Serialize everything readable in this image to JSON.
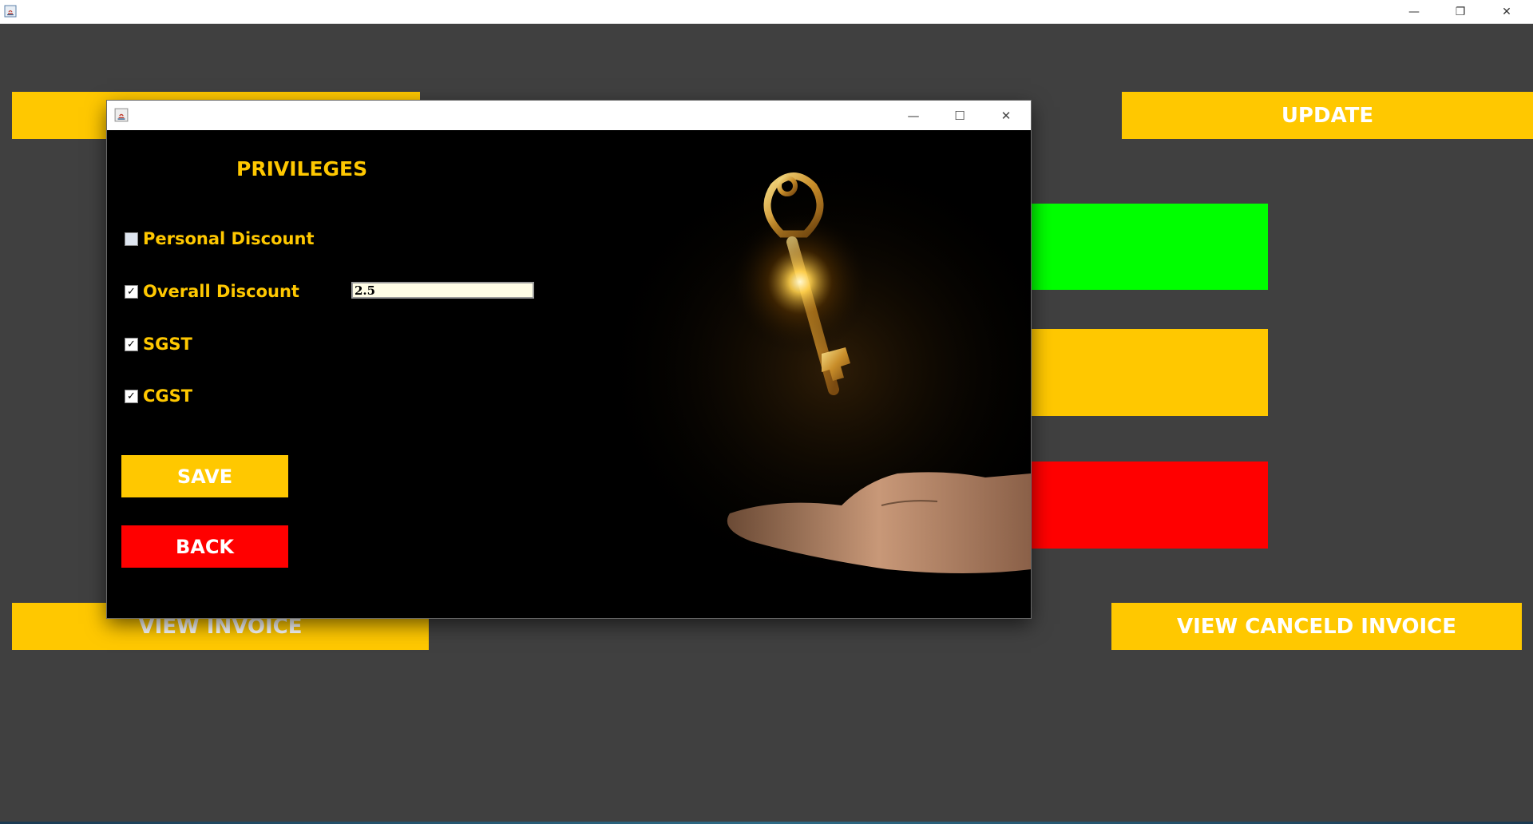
{
  "window": {
    "minimize_glyph": "—",
    "restore_glyph": "❐",
    "close_glyph": "✕"
  },
  "background": {
    "update_label": "UPDATE",
    "view_invoice_label": "VIEW INVOICE",
    "view_canceled_label": "VIEW CANCELD INVOICE",
    "colors": {
      "yellow": "#FFC800",
      "green": "#00FF00",
      "red": "#FF0000",
      "bg": "#404040"
    }
  },
  "dialog": {
    "minimize_glyph": "—",
    "maximize_glyph": "☐",
    "close_glyph": "✕",
    "heading": "PRIVILEGES",
    "options": [
      {
        "label": "Personal Discount",
        "checked": false
      },
      {
        "label": "Overall Discount",
        "checked": true
      },
      {
        "label": "SGST",
        "checked": true
      },
      {
        "label": "CGST",
        "checked": true
      }
    ],
    "overall_discount_value": "2.5",
    "save_label": "SAVE",
    "back_label": "BACK",
    "image_icon": "golden-key-on-hand-icon"
  }
}
